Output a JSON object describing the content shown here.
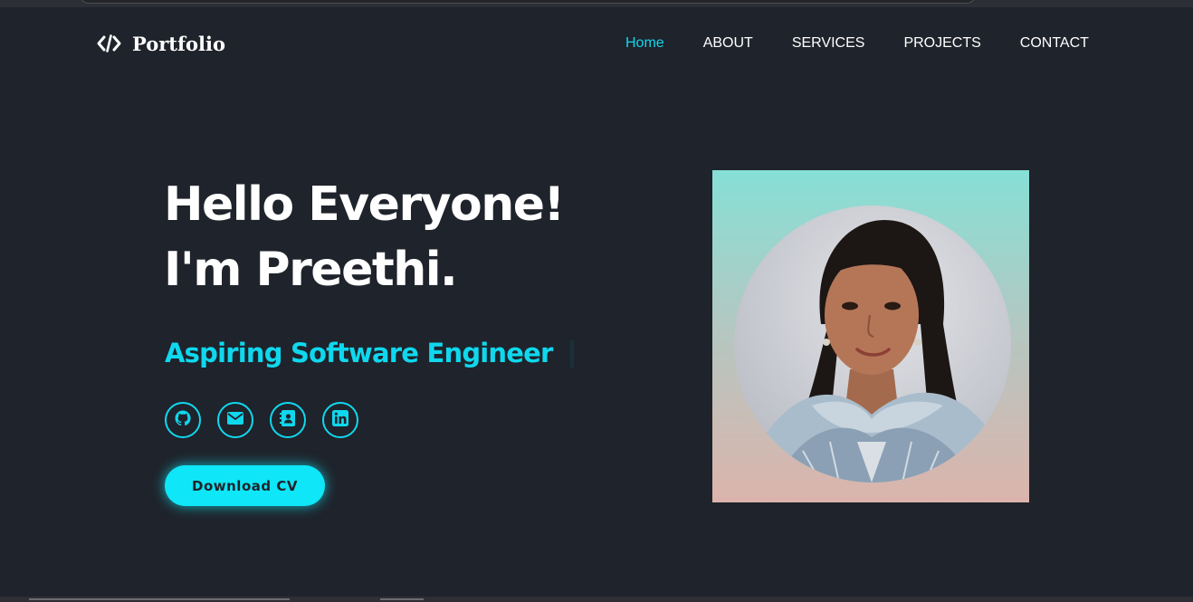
{
  "brand": {
    "name": "Portfolio",
    "icon": "code-icon"
  },
  "nav": {
    "links": [
      {
        "label": "Home",
        "active": true
      },
      {
        "label": "ABOUT",
        "active": false
      },
      {
        "label": "SERVICES",
        "active": false
      },
      {
        "label": "PROJECTS",
        "active": false
      },
      {
        "label": "CONTACT",
        "active": false
      }
    ]
  },
  "hero": {
    "line1": "Hello Everyone!",
    "line2": "I'm Preethi.",
    "subtitle": "Aspiring Software Engineer",
    "socials": [
      {
        "icon": "github-icon"
      },
      {
        "icon": "email-icon"
      },
      {
        "icon": "contact-card-icon"
      },
      {
        "icon": "linkedin-icon"
      }
    ],
    "cv_button": "Download CV"
  },
  "profile_photo": {
    "icon": "profile-photo"
  },
  "colors": {
    "background": "#1f232b",
    "accent": "#0fd8ee",
    "button": "#0fe6f7",
    "text": "#ffffff"
  }
}
